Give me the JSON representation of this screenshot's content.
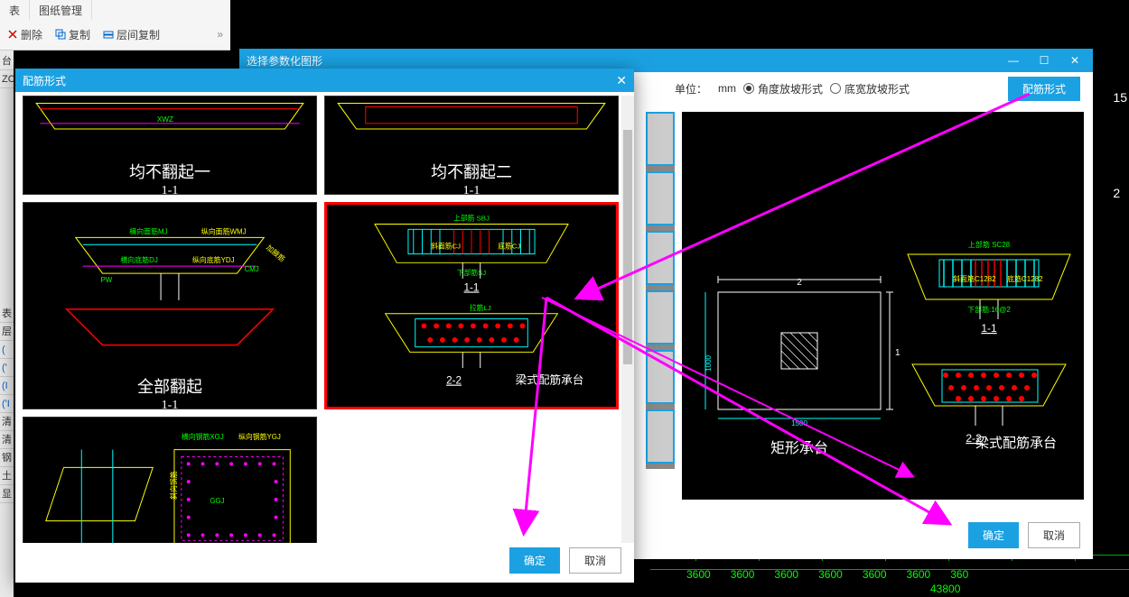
{
  "ribbon": {
    "tabs": [
      "表",
      "图纸管理"
    ],
    "buttons": {
      "delete": "删除",
      "copy": "复制",
      "layer_copy": "层间复制"
    }
  },
  "left_panel": [
    "台",
    "ZC"
  ],
  "left_labels": [
    "表",
    "层",
    "(",
    "('",
    "(I",
    "('I",
    "清",
    "清",
    "钢",
    "土",
    "显"
  ],
  "dialog_outer": {
    "title": "选择参数化图形",
    "unit_label": "单位：",
    "unit_value": "mm",
    "radios": [
      {
        "label": "角度放坡形式",
        "selected": true
      },
      {
        "label": "底宽放坡形式",
        "selected": false
      }
    ],
    "style_button": "配筋形式",
    "preview": {
      "left_caption": "矩形承台",
      "left_dims": {
        "top": "2",
        "right": "1",
        "bottom": "1500",
        "left": "1000",
        "hatch": true
      },
      "right_caption": "梁式配筋承台",
      "right_sub_top": "1-1",
      "right_sub_bot": "2-2",
      "right_labels": {
        "top": "上部筋 SC28",
        "mid_l": "斜面筋C1282",
        "mid_r": "底筋C1282",
        "bot": "下部筋:16@2"
      }
    },
    "ok": "确定",
    "cancel": "取消"
  },
  "dialog_inner": {
    "title": "配筋形式",
    "tiles": [
      {
        "caption": "均不翻起一",
        "sub": "1-1",
        "selected": false,
        "kind": "top_a"
      },
      {
        "caption": "均不翻起二",
        "sub": "1-1",
        "selected": false,
        "kind": "top_b"
      },
      {
        "caption": "全部翻起",
        "sub": "1-1",
        "selected": false,
        "kind": "detail_a",
        "labels": {
          "hx_top": "横向面筋MJ",
          "zx_top": "纵向面筋WMJ",
          "jy": "加腋筋",
          "hx_bot": "横向底筋DJ",
          "zx_bot": "纵向底筋YDJ",
          "cmj": "CMJ",
          "pw": "PW"
        }
      },
      {
        "caption": "",
        "sub": "",
        "selected": true,
        "kind": "detail_b",
        "labels": {
          "top": "上部筋 SBJ",
          "hx": "斜面筋CJ",
          "cj": "底筋CJ",
          "bot": "下部筋SJ",
          "sub1": "1-1",
          "tj": "拉筋LJ",
          "sub2": "2-2",
          "right_cap": "梁式配筋承台"
        }
      },
      {
        "caption": "",
        "sub": "",
        "selected": false,
        "kind": "rect_rebar",
        "labels": {
          "hx": "横向钢筋XGJ",
          "zx": "纵向钢筋YGJ",
          "gj": "GGJ",
          "side": "斜向钢筋"
        }
      }
    ],
    "ok": "确定",
    "cancel": "取消"
  },
  "cad_background": {
    "dims_bottom": [
      "3600",
      "3600",
      "3600",
      "3600",
      "3600",
      "3600",
      "360"
    ],
    "dim_overall": "43800",
    "right_nums": [
      "15",
      "2"
    ]
  }
}
